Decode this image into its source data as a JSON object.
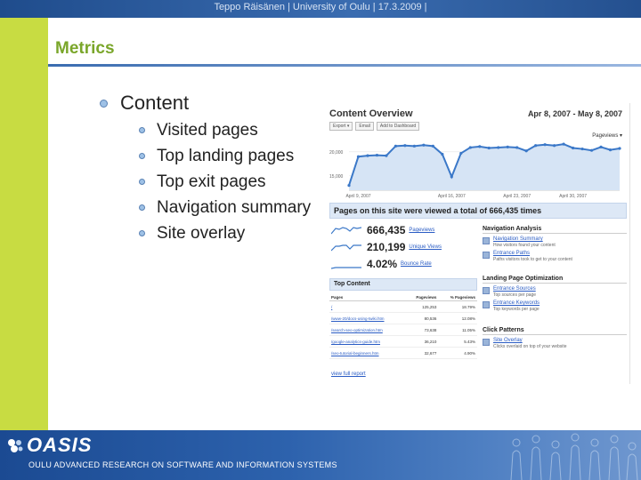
{
  "header": {
    "text": "Teppo Räisänen | University of Oulu | 17.3.2009 |"
  },
  "slide": {
    "title": "Metrics",
    "bullet_main": "Content",
    "bullets": [
      "Visited pages",
      "Top landing pages",
      "Top exit pages",
      "Navigation summary",
      "Site overlay"
    ]
  },
  "analytics": {
    "title": "Content Overview",
    "date_range": "Apr 8, 2007 - May 8, 2007",
    "tools": [
      "Export ▾",
      "Email",
      "Add to Dashboard"
    ],
    "metric_select": "Pageviews ▾",
    "total_text": "Pages on this site were viewed a total of 666,435 times",
    "metrics": [
      {
        "value": "666,435",
        "label": "Pageviews"
      },
      {
        "value": "210,199",
        "label": "Unique Views"
      },
      {
        "value": "4.02%",
        "label": "Bounce Rate"
      }
    ],
    "navigation": {
      "heading": "Navigation Analysis",
      "items": [
        {
          "link": "Navigation Summary",
          "desc": "How visitors found your content"
        },
        {
          "link": "Entrance Paths",
          "desc": "Paths visitors took to get to your content"
        }
      ]
    },
    "landing": {
      "heading": "Landing Page Optimization",
      "items": [
        {
          "link": "Entrance Sources",
          "desc": "Top sources per page"
        },
        {
          "link": "Entrance Keywords",
          "desc": "Top keywords per page"
        }
      ]
    },
    "click": {
      "heading": "Click Patterns",
      "items": [
        {
          "link": "Site Overlay",
          "desc": "Clicks overlaid on top of your website"
        }
      ]
    },
    "top_content": {
      "heading": "Top Content",
      "columns": [
        "Pages",
        "Pageviews",
        "% Pageviews"
      ],
      "rows": [
        [
          "/",
          "125,253",
          "18.79%"
        ],
        [
          "/www-20/docs-using-twiki.htm",
          "80,536",
          "12.08%"
        ],
        [
          "/search-seo-optimization.htm",
          "73,638",
          "11.05%"
        ],
        [
          "/google-analytics-guide.htm",
          "36,210",
          "5.43%"
        ],
        [
          "/seo-tutorial-beginners.htm",
          "32,677",
          "4.90%"
        ]
      ],
      "view_full": "view full report"
    },
    "chart_data": {
      "type": "line",
      "x_labels": [
        "April 9, 2007",
        "April 16, 2007",
        "April 23, 2007",
        "April 30, 2007"
      ],
      "y_ticks": [
        "20,000",
        "15,000"
      ],
      "ylim": [
        12000,
        22000
      ],
      "values": [
        13000,
        19000,
        19200,
        19300,
        19200,
        21200,
        21300,
        21200,
        21400,
        21200,
        19500,
        14800,
        19700,
        20900,
        21100,
        20800,
        20900,
        21000,
        20900,
        20200,
        21300,
        21500,
        21300,
        21600,
        20800,
        20600,
        20300,
        21000,
        20400,
        20700
      ]
    }
  },
  "footer": {
    "logo": "OASIS",
    "text": "OULU ADVANCED RESEARCH ON SOFTWARE AND INFORMATION SYSTEMS"
  }
}
